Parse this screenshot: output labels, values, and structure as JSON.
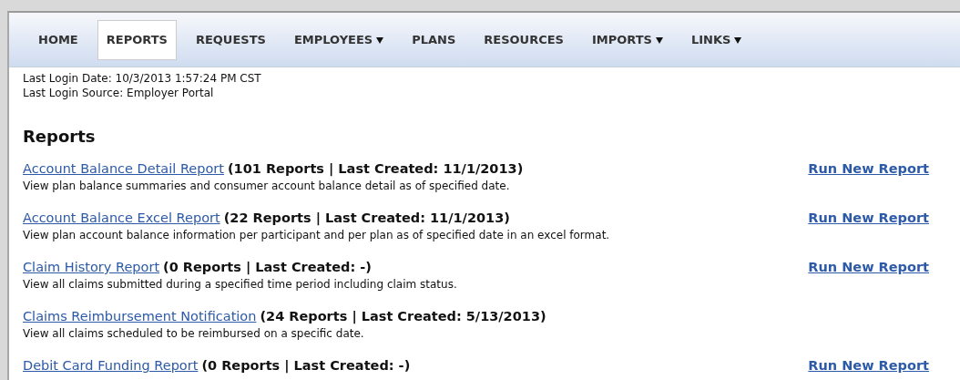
{
  "nav": [
    {
      "label": "HOME",
      "selected": false,
      "dropdown": false
    },
    {
      "label": "REPORTS",
      "selected": true,
      "dropdown": false
    },
    {
      "label": "REQUESTS",
      "selected": false,
      "dropdown": false
    },
    {
      "label": "EMPLOYEES",
      "selected": false,
      "dropdown": true
    },
    {
      "label": "PLANS",
      "selected": false,
      "dropdown": false
    },
    {
      "label": "RESOURCES",
      "selected": false,
      "dropdown": false
    },
    {
      "label": "IMPORTS",
      "selected": false,
      "dropdown": true
    },
    {
      "label": "LINKS",
      "selected": false,
      "dropdown": true
    }
  ],
  "login": [
    "Last Login Date: 10/3/2013 1:57:24 PM CST",
    "Last Login Source: Employer Portal"
  ],
  "heading": "Reports",
  "reports": [
    {
      "title": "Account Balance Detail Report",
      "summary": "(101 Reports | Last Created: 11/1/2013)",
      "description": "View plan balance summaries and consumer account balance detail as of specified date.",
      "action": "Run New Report"
    },
    {
      "title": "Account Balance Excel Report",
      "summary": "(22 Reports | Last Created: 11/1/2013)",
      "description": "View plan account balance information per participant and per plan as of specified date in an excel format.",
      "action": "Run New Report"
    },
    {
      "title": "Claim History Report",
      "summary": "(0 Reports | Last Created: -)",
      "description": "View all claims submitted during a specified time period including claim status.",
      "action": "Run New Report"
    },
    {
      "title": "Claims Reimbursement Notification",
      "summary": "(24 Reports | Last Created: 5/13/2013)",
      "description": "View all claims scheduled to be reimbursed on a specific date."
    },
    {
      "title": "Debit Card Funding Report",
      "summary": "(0 Reports | Last Created: -)",
      "action": "Run New Report"
    }
  ]
}
